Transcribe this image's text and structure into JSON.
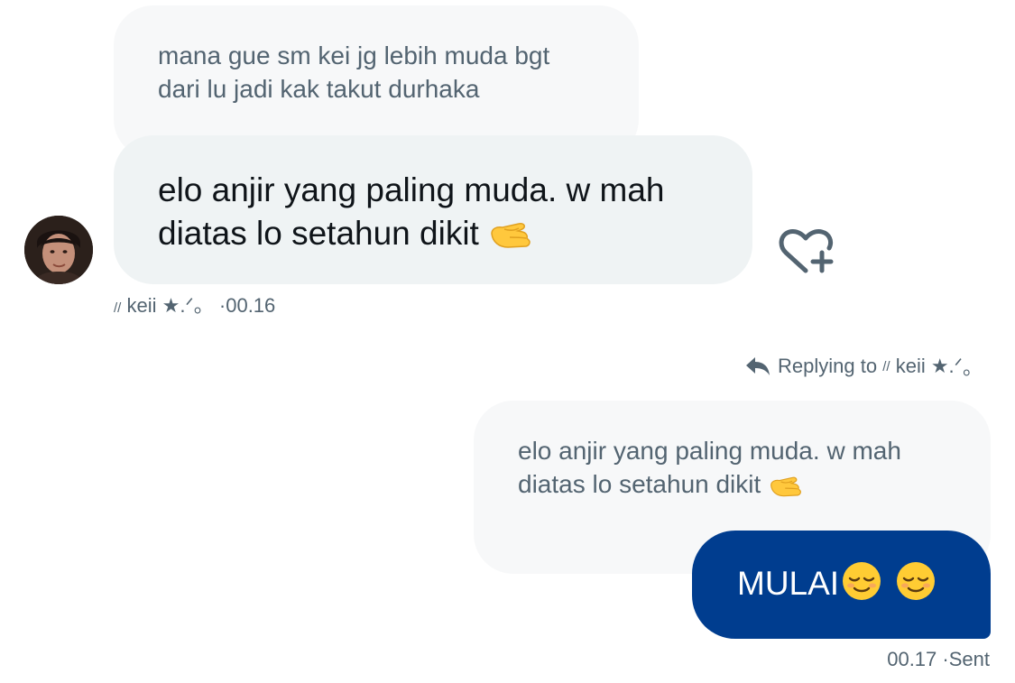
{
  "incoming": {
    "quoted_text": "mana gue sm kei jg lebih muda bgt\ndari lu jadi kak takut durhaka",
    "message_text": "elo anjir yang paling muda. w mah\ndiatas lo setahun dikit",
    "message_emoji": "pinching-hand-emoji",
    "sender_prefix": "//",
    "sender_name": "keii ★.ᐟ",
    "sender_suffix": "。",
    "separator": "·",
    "timestamp": "00.16",
    "react_icon": "heart-plus-icon"
  },
  "reply_context": {
    "icon": "reply-arrow-icon",
    "label": "Replying to",
    "prefix": "//",
    "name": "keii ★.ᐟ",
    "suffix": "。"
  },
  "outgoing": {
    "quoted_text": "elo anjir yang paling muda. w mah\ndiatas lo setahun dikit",
    "quoted_emoji": "pinching-hand-emoji",
    "message_text": "MULAI",
    "message_emojis": [
      "relieved-face-emoji",
      "relieved-face-emoji"
    ],
    "timestamp": "00.17",
    "separator": "·",
    "status": "Sent",
    "bubble_color": "#003d8f"
  }
}
